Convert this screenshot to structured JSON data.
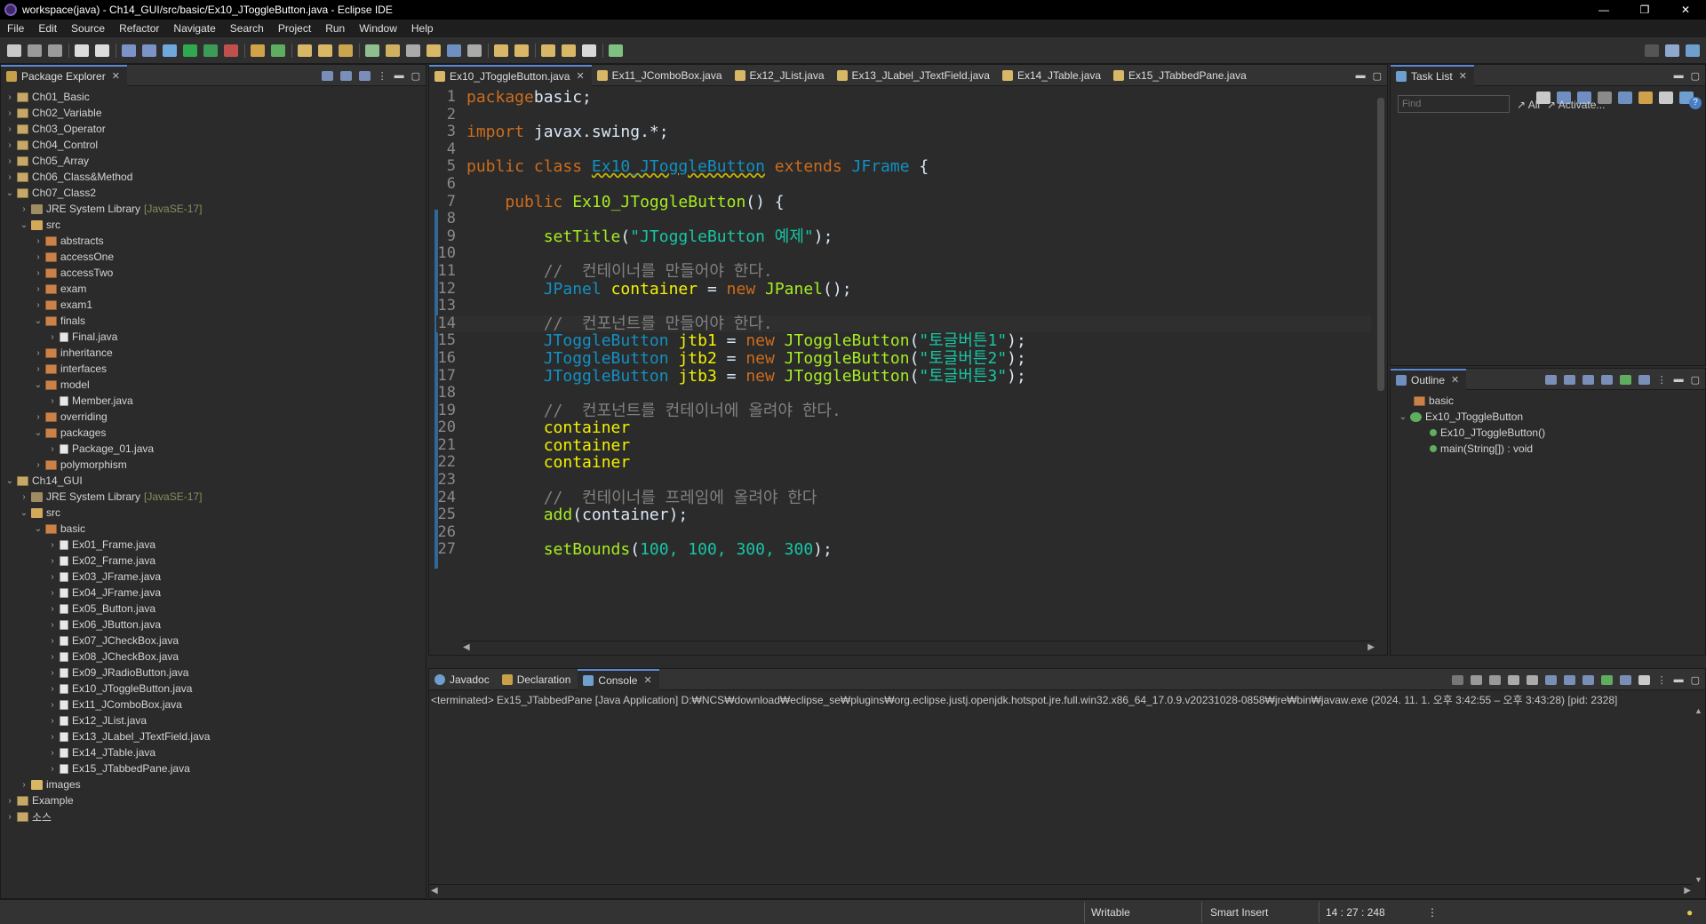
{
  "window": {
    "title": "workspace(java) - Ch14_GUI/src/basic/Ex10_JToggleButton.java - Eclipse IDE",
    "controls": [
      "—",
      "❐",
      "✕"
    ]
  },
  "menu": [
    "File",
    "Edit",
    "Source",
    "Refactor",
    "Navigate",
    "Search",
    "Project",
    "Run",
    "Window",
    "Help"
  ],
  "package_explorer": {
    "title": "Package Explorer",
    "tree": [
      {
        "label": "Ch01_Basic",
        "depth": 0,
        "icon": "project",
        "expanded": false
      },
      {
        "label": "Ch02_Variable",
        "depth": 0,
        "icon": "project",
        "expanded": false
      },
      {
        "label": "Ch03_Operator",
        "depth": 0,
        "icon": "project",
        "expanded": false
      },
      {
        "label": "Ch04_Control",
        "depth": 0,
        "icon": "project",
        "expanded": false
      },
      {
        "label": "Ch05_Array",
        "depth": 0,
        "icon": "project",
        "expanded": false
      },
      {
        "label": "Ch06_Class&Method",
        "depth": 0,
        "icon": "project",
        "expanded": false
      },
      {
        "label": "Ch07_Class2",
        "depth": 0,
        "icon": "project",
        "expanded": true
      },
      {
        "label": "JRE System Library",
        "suffix": "[JavaSE-17]",
        "depth": 1,
        "icon": "library",
        "expanded": false
      },
      {
        "label": "src",
        "depth": 1,
        "icon": "src",
        "expanded": true
      },
      {
        "label": "abstracts",
        "depth": 2,
        "icon": "package",
        "expanded": false
      },
      {
        "label": "accessOne",
        "depth": 2,
        "icon": "package",
        "expanded": false
      },
      {
        "label": "accessTwo",
        "depth": 2,
        "icon": "package",
        "expanded": false
      },
      {
        "label": "exam",
        "depth": 2,
        "icon": "package",
        "expanded": false
      },
      {
        "label": "exam1",
        "depth": 2,
        "icon": "package",
        "expanded": false
      },
      {
        "label": "finals",
        "depth": 2,
        "icon": "package",
        "expanded": true
      },
      {
        "label": "Final.java",
        "depth": 3,
        "icon": "java",
        "expanded": false
      },
      {
        "label": "inheritance",
        "depth": 2,
        "icon": "package",
        "expanded": false
      },
      {
        "label": "interfaces",
        "depth": 2,
        "icon": "package",
        "expanded": false
      },
      {
        "label": "model",
        "depth": 2,
        "icon": "package",
        "expanded": true
      },
      {
        "label": "Member.java",
        "depth": 3,
        "icon": "java",
        "expanded": false
      },
      {
        "label": "overriding",
        "depth": 2,
        "icon": "package",
        "expanded": false
      },
      {
        "label": "packages",
        "depth": 2,
        "icon": "package",
        "expanded": true
      },
      {
        "label": "Package_01.java",
        "depth": 3,
        "icon": "java",
        "expanded": false
      },
      {
        "label": "polymorphism",
        "depth": 2,
        "icon": "package",
        "expanded": false
      },
      {
        "label": "Ch14_GUI",
        "depth": 0,
        "icon": "project",
        "expanded": true
      },
      {
        "label": "JRE System Library",
        "suffix": "[JavaSE-17]",
        "depth": 1,
        "icon": "library",
        "expanded": false
      },
      {
        "label": "src",
        "depth": 1,
        "icon": "src",
        "expanded": true
      },
      {
        "label": "basic",
        "depth": 2,
        "icon": "package",
        "expanded": true
      },
      {
        "label": "Ex01_Frame.java",
        "depth": 3,
        "icon": "java",
        "expanded": false
      },
      {
        "label": "Ex02_Frame.java",
        "depth": 3,
        "icon": "java",
        "expanded": false
      },
      {
        "label": "Ex03_JFrame.java",
        "depth": 3,
        "icon": "java",
        "expanded": false
      },
      {
        "label": "Ex04_JFrame.java",
        "depth": 3,
        "icon": "java",
        "expanded": false
      },
      {
        "label": "Ex05_Button.java",
        "depth": 3,
        "icon": "java",
        "expanded": false
      },
      {
        "label": "Ex06_JButton.java",
        "depth": 3,
        "icon": "java",
        "expanded": false
      },
      {
        "label": "Ex07_JCheckBox.java",
        "depth": 3,
        "icon": "java",
        "expanded": false
      },
      {
        "label": "Ex08_JCheckBox.java",
        "depth": 3,
        "icon": "java",
        "expanded": false
      },
      {
        "label": "Ex09_JRadioButton.java",
        "depth": 3,
        "icon": "java",
        "expanded": false
      },
      {
        "label": "Ex10_JToggleButton.java",
        "depth": 3,
        "icon": "java",
        "expanded": false
      },
      {
        "label": "Ex11_JComboBox.java",
        "depth": 3,
        "icon": "java",
        "expanded": false
      },
      {
        "label": "Ex12_JList.java",
        "depth": 3,
        "icon": "java",
        "expanded": false
      },
      {
        "label": "Ex13_JLabel_JTextField.java",
        "depth": 3,
        "icon": "java",
        "expanded": false
      },
      {
        "label": "Ex14_JTable.java",
        "depth": 3,
        "icon": "java",
        "expanded": false
      },
      {
        "label": "Ex15_JTabbedPane.java",
        "depth": 3,
        "icon": "java",
        "expanded": false
      },
      {
        "label": "images",
        "depth": 1,
        "icon": "folder",
        "expanded": false
      },
      {
        "label": "Example",
        "depth": 0,
        "icon": "project",
        "expanded": false
      },
      {
        "label": "소스",
        "depth": 0,
        "icon": "project",
        "expanded": false
      }
    ]
  },
  "editor": {
    "tabs": [
      {
        "label": "Ex10_JToggleButton.java",
        "active": true
      },
      {
        "label": "Ex11_JComboBox.java",
        "active": false
      },
      {
        "label": "Ex12_JList.java",
        "active": false
      },
      {
        "label": "Ex13_JLabel_JTextField.java",
        "active": false
      },
      {
        "label": "Ex14_JTable.java",
        "active": false
      },
      {
        "label": "Ex15_JTabbedPane.java",
        "active": false
      }
    ],
    "lines": [
      {
        "n": "1",
        "parts": [
          [
            "kw",
            "package"
          ],
          [
            "",
            "basic;"
          ]
        ]
      },
      {
        "n": "2",
        "parts": []
      },
      {
        "n": "3",
        "parts": [
          [
            "kw",
            "import"
          ],
          [
            "",
            " javax.swing.*;"
          ]
        ]
      },
      {
        "n": "4",
        "parts": []
      },
      {
        "n": "5",
        "parts": [
          [
            "kw",
            "public class "
          ],
          [
            "und",
            "Ex10_JToggleButton"
          ],
          [
            "kw",
            " extends "
          ],
          [
            "ty",
            "JFrame"
          ],
          [
            "",
            " {"
          ]
        ]
      },
      {
        "n": "6",
        "parts": []
      },
      {
        "n": "7",
        "parts": [
          [
            "",
            "    "
          ],
          [
            "kw",
            "public "
          ],
          [
            "fn",
            "Ex10_JToggleButton"
          ],
          [
            "",
            "() {"
          ]
        ]
      },
      {
        "n": "8",
        "parts": []
      },
      {
        "n": "9",
        "parts": [
          [
            "",
            "        "
          ],
          [
            "mt",
            "setTitle"
          ],
          [
            "",
            "("
          ],
          [
            "str",
            "\"JToggleButton 예제\""
          ],
          [
            "",
            ");"
          ]
        ]
      },
      {
        "n": "10",
        "parts": []
      },
      {
        "n": "11",
        "parts": [
          [
            "",
            "        "
          ],
          [
            "cm",
            "//  컨테이너를 만들어야 한다."
          ]
        ]
      },
      {
        "n": "12",
        "parts": [
          [
            "",
            "        "
          ],
          [
            "ty",
            "JPanel"
          ],
          [
            "",
            " "
          ],
          [
            "var",
            "container"
          ],
          [
            "",
            " = "
          ],
          [
            "kw",
            "new "
          ],
          [
            "fn",
            "JPanel"
          ],
          [
            "",
            "();"
          ]
        ]
      },
      {
        "n": "13",
        "parts": []
      },
      {
        "n": "14",
        "parts": [
          [
            "",
            "        "
          ],
          [
            "cm",
            "//  컨포넌트를 만들어야 한다."
          ]
        ],
        "current": true
      },
      {
        "n": "15",
        "parts": [
          [
            "",
            "        "
          ],
          [
            "ty",
            "JToggleButton"
          ],
          [
            "",
            " "
          ],
          [
            "var",
            "jtb1"
          ],
          [
            "",
            " = "
          ],
          [
            "kw",
            "new "
          ],
          [
            "fn",
            "JToggleButton"
          ],
          [
            "",
            "("
          ],
          [
            "str",
            "\"토글버튼1\""
          ],
          [
            "",
            ");"
          ]
        ]
      },
      {
        "n": "16",
        "parts": [
          [
            "",
            "        "
          ],
          [
            "ty",
            "JToggleButton"
          ],
          [
            "",
            " "
          ],
          [
            "var",
            "jtb2"
          ],
          [
            "",
            " = "
          ],
          [
            "kw",
            "new "
          ],
          [
            "fn",
            "JToggleButton"
          ],
          [
            "",
            "("
          ],
          [
            "str",
            "\"토글버튼2\""
          ],
          [
            "",
            ");"
          ]
        ]
      },
      {
        "n": "17",
        "parts": [
          [
            "",
            "        "
          ],
          [
            "ty",
            "JToggleButton"
          ],
          [
            "",
            " "
          ],
          [
            "var",
            "jtb3"
          ],
          [
            "",
            " = "
          ],
          [
            "kw",
            "new "
          ],
          [
            "fn",
            "JToggleButton"
          ],
          [
            "",
            "("
          ],
          [
            "str",
            "\"토글버튼3\""
          ],
          [
            "",
            ");"
          ]
        ]
      },
      {
        "n": "18",
        "parts": []
      },
      {
        "n": "19",
        "parts": [
          [
            "",
            "        "
          ],
          [
            "cm",
            "//  컨포넌트를 컨테이너에 올려야 한다."
          ]
        ]
      },
      {
        "n": "20",
        "parts": [
          [
            "",
            "        "
          ],
          [
            "var",
            "container"
          ],
          [
            ".add(jtb1);"
          ]
        ]
      },
      {
        "n": "21",
        "parts": [
          [
            "",
            "        "
          ],
          [
            "var",
            "container"
          ],
          [
            ".add(jtb2);"
          ]
        ]
      },
      {
        "n": "22",
        "parts": [
          [
            "",
            "        "
          ],
          [
            "var",
            "container"
          ],
          [
            ".add(jtb3);"
          ]
        ]
      },
      {
        "n": "23",
        "parts": []
      },
      {
        "n": "24",
        "parts": [
          [
            "",
            "        "
          ],
          [
            "cm",
            "//  컨테이너를 프레임에 올려야 한다"
          ]
        ]
      },
      {
        "n": "25",
        "parts": [
          [
            "",
            "        "
          ],
          [
            "mt",
            "add"
          ],
          [
            "",
            "(container);"
          ]
        ]
      },
      {
        "n": "26",
        "parts": []
      },
      {
        "n": "27",
        "parts": [
          [
            "",
            "        "
          ],
          [
            "mt",
            "setBounds"
          ],
          [
            "",
            "("
          ],
          [
            "str",
            "100, 100, 300, 300"
          ],
          [
            "",
            ");"
          ]
        ]
      }
    ]
  },
  "task_list": {
    "title": "Task List",
    "find_placeholder": "Find",
    "all_label": "All",
    "activate_label": "Activate..."
  },
  "outline": {
    "title": "Outline",
    "items": [
      {
        "label": "basic",
        "depth": 0
      },
      {
        "label": "Ex10_JToggleButton",
        "depth": 0,
        "expanded": true
      },
      {
        "label": "Ex10_JToggleButton()",
        "depth": 1
      },
      {
        "label": "main(String[]) : void",
        "depth": 1
      }
    ]
  },
  "bottom_panel": {
    "tabs": [
      {
        "label": "Javadoc",
        "active": false
      },
      {
        "label": "Declaration",
        "active": false
      },
      {
        "label": "Console",
        "active": true
      }
    ],
    "console_line": "<terminated> Ex15_JTabbedPane [Java Application] D:₩NCS₩download₩eclipse_se₩plugins₩org.eclipse.justj.openjdk.hotspot.jre.full.win32.x86_64_17.0.9.v20231028-0858₩jre₩bin₩javaw.exe  (2024. 11. 1. 오후 3:42:55 – 오후 3:43:28) [pid: 2328]"
  },
  "status": {
    "writable": "Writable",
    "insert_mode": "Smart Insert",
    "position": "14 : 27 : 248"
  }
}
